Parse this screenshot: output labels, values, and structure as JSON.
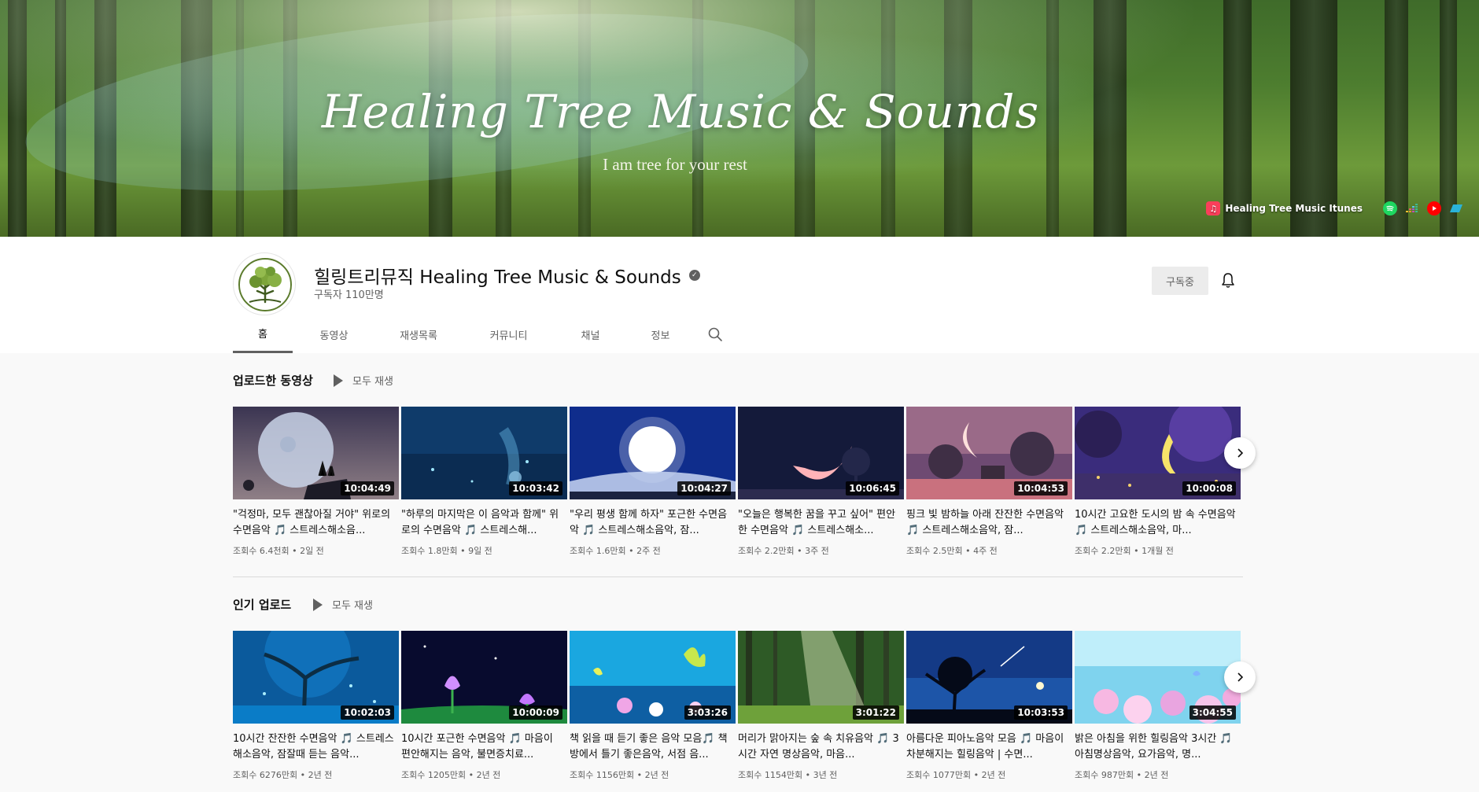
{
  "banner": {
    "title": "Healing Tree Music & Sounds",
    "subtitle": "I am tree for your rest",
    "link_main": "Healing Tree Music Itunes",
    "links": [
      "spotify-icon",
      "deezer-icon",
      "youtube-music-icon",
      "tidal-icon"
    ]
  },
  "channel": {
    "name": "힐링트리뮤직 Healing Tree Music & Sounds",
    "subscribers": "구독자 110만명",
    "subscribe_label": "구독중"
  },
  "tabs": [
    {
      "label": "홈",
      "active": true
    },
    {
      "label": "동영상"
    },
    {
      "label": "재생목록"
    },
    {
      "label": "커뮤니티"
    },
    {
      "label": "채널"
    },
    {
      "label": "정보"
    }
  ],
  "sections": [
    {
      "title": "업로드한 동영상",
      "play_all": "모두 재생",
      "videos": [
        {
          "title": "\"걱정마, 모두 괜찮아질 거야\" 위로의 수면음악 🎵 스트레스해소음...",
          "duration": "10:04:49",
          "meta": "조회수 6.4천회 • 2일 전",
          "palette": "moon"
        },
        {
          "title": "\"하루의 마지막은 이 음악과 함께\" 위로의 수면음악 🎵 스트레스해...",
          "duration": "10:03:42",
          "meta": "조회수 1.8만회 • 9일 전",
          "palette": "bluenight"
        },
        {
          "title": "\"우리 평생 함께 하자\" 포근한 수면음악 🎵 스트레스해소음악, 잠...",
          "duration": "10:04:27",
          "meta": "조회수 1.6만회 • 2주 전",
          "palette": "fullmoon"
        },
        {
          "title": "\"오늘은 행복한 꿈을 꾸고 싶어\" 편안한 수면음악 🎵 스트레스해소...",
          "duration": "10:06:45",
          "meta": "조회수 2.2만회 • 3주 전",
          "palette": "crescent"
        },
        {
          "title": "핑크 빛 밤하늘 아래 잔잔한 수면음악 🎵 스트레스해소음악, 잠...",
          "duration": "10:04:53",
          "meta": "조회수 2.5만회 • 4주 전",
          "palette": "pink"
        },
        {
          "title": "10시간 고요한 도시의 밤 속 수면음악 🎵 스트레스해소음악, 마...",
          "duration": "10:00:08",
          "meta": "조회수 2.2만회 • 1개월 전",
          "palette": "city"
        }
      ]
    },
    {
      "title": "인기 업로드",
      "play_all": "모두 재생",
      "videos": [
        {
          "title": "10시간 잔잔한 수면음악 🎵 스트레스 해소음악, 잠잘때 듣는 음악...",
          "duration": "10:02:03",
          "meta": "조회수 6276만회 • 2년 전",
          "palette": "bluetree"
        },
        {
          "title": "10시간 포근한 수면음악 🎵 마음이 편안해지는 음악, 불면증치료...",
          "duration": "10:00:09",
          "meta": "조회수 1205만회 • 2년 전",
          "palette": "tulip"
        },
        {
          "title": "책 읽을 때 듣기 좋은 음악 모음🎵 책방에서 틀기 좋은음악, 서점 음...",
          "duration": "3:03:26",
          "meta": "조회수 1156만회 • 2년 전",
          "palette": "butterfly"
        },
        {
          "title": "머리가 맑아지는 숲 속 치유음악 🎵 3시간 자연 명상음악, 마음...",
          "duration": "3:01:22",
          "meta": "조회수 1154만회 • 3년 전",
          "palette": "forest"
        },
        {
          "title": "아름다운 피아노음악 모음 🎵 마음이 차분해지는 힐링음악 | 수면...",
          "duration": "10:03:53",
          "meta": "조회수 1077만회 • 2년 전",
          "palette": "silhouette"
        },
        {
          "title": "밝은 아침을 위한 힐링음악 3시간 🎵 아침명상음악, 요가음악, 명...",
          "duration": "3:04:55",
          "meta": "조회수 987만회 • 2년 전",
          "palette": "flowers"
        }
      ]
    }
  ]
}
